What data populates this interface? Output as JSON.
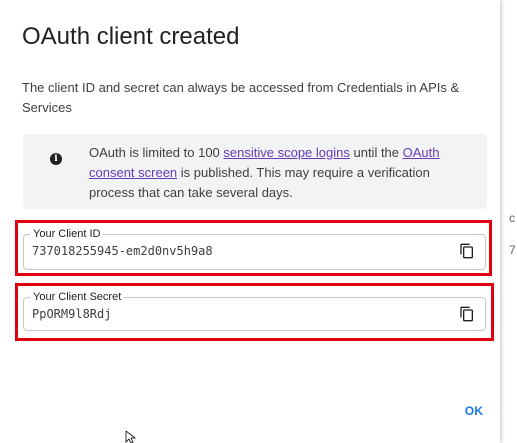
{
  "dialog": {
    "title": "OAuth client created",
    "description": "The client ID and secret can always be accessed from Credentials in APIs & Services"
  },
  "info": {
    "icon": "info-icon",
    "text_before": "OAuth is limited to 100 ",
    "link_scope": "sensitive scope logins",
    "text_middle": " until the ",
    "link_consent": "OAuth consent screen",
    "text_after": " is published. This may require a verification process that can take several days."
  },
  "client_id": {
    "label": "Your Client ID",
    "value": "737018255945-em2d0nv5h9a8",
    "copy_icon": "copy-icon"
  },
  "client_secret": {
    "label": "Your Client Secret",
    "value": "PpORM9l8Rdj",
    "copy_icon": "copy-icon"
  },
  "actions": {
    "ok_label": "OK"
  },
  "background": {
    "fragment_1": "c",
    "fragment_2": "7"
  },
  "colors": {
    "link": "#673ab7",
    "primary": "#1a73e8",
    "highlight": "#e0000f"
  }
}
